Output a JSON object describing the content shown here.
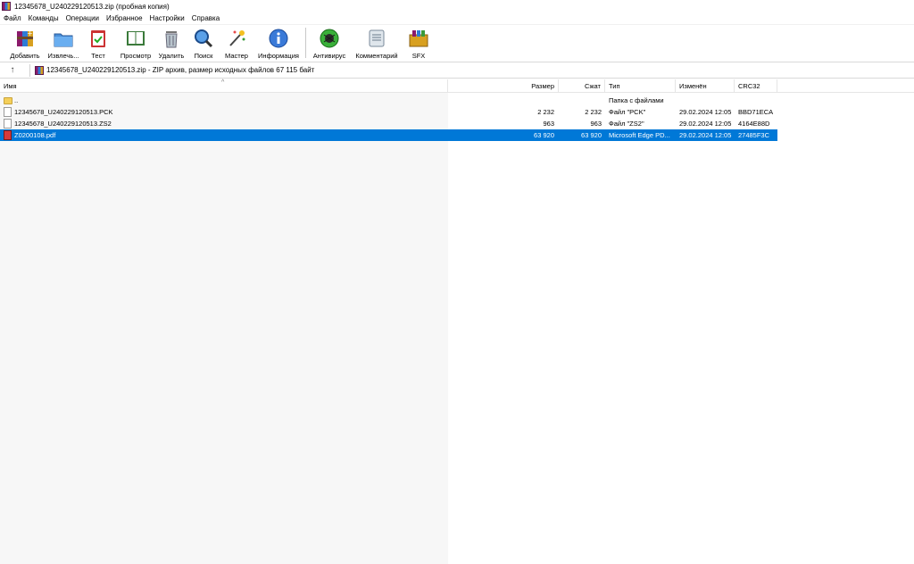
{
  "window": {
    "title": "12345678_U240229120513.zip (пробная копия)"
  },
  "menu": [
    "Файл",
    "Команды",
    "Операции",
    "Избранное",
    "Настройки",
    "Справка"
  ],
  "toolbar": {
    "add": "Добавить",
    "extract": "Извлечь...",
    "test": "Тест",
    "view": "Просмотр",
    "delete": "Удалить",
    "find": "Поиск",
    "wizard": "Мастер",
    "info": "Информация",
    "antivirus": "Антивирус",
    "comment": "Комментарий",
    "sfx": "SFX"
  },
  "address": {
    "text": "12345678_U240229120513.zip - ZIP архив, размер исходных файлов 67 115 байт"
  },
  "columns": {
    "name": "Имя",
    "size": "Размер",
    "packed": "Сжат",
    "type": "Тип",
    "modified": "Изменён",
    "crc": "CRC32"
  },
  "rows": [
    {
      "name": "..",
      "size": "",
      "packed": "",
      "type": "Папка с файлами",
      "modified": "",
      "crc": "",
      "icon": "folder-icon"
    },
    {
      "name": "12345678_U240229120513.PCK",
      "size": "2 232",
      "packed": "2 232",
      "type": "Файл \"PCK\"",
      "modified": "29.02.2024 12:05",
      "crc": "BBD71ECA",
      "icon": "file-icon"
    },
    {
      "name": "12345678_U240229120513.ZS2",
      "size": "963",
      "packed": "963",
      "type": "Файл \"ZS2\"",
      "modified": "29.02.2024 12:05",
      "crc": "4164E88D",
      "icon": "file-icon"
    },
    {
      "name": "Z0200108.pdf",
      "size": "63 920",
      "packed": "63 920",
      "type": "Microsoft Edge PD...",
      "modified": "29.02.2024 12:05",
      "crc": "27485F3C",
      "icon": "pdf-icon"
    }
  ],
  "colors": {
    "selection": "#0078d7"
  }
}
